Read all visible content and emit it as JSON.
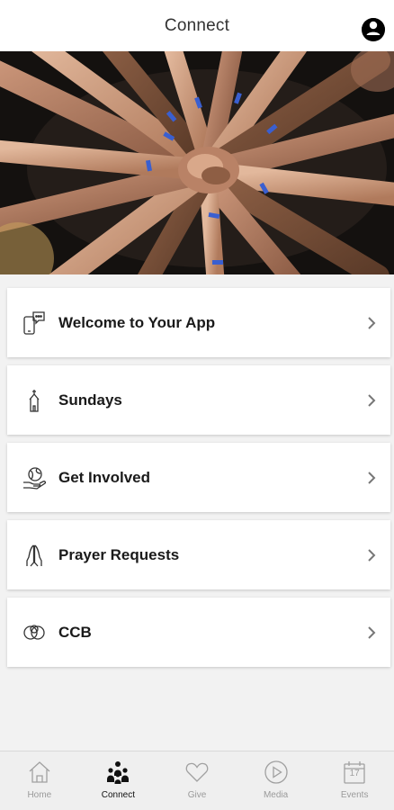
{
  "header": {
    "title": "Connect"
  },
  "hero": {
    "image": "hands-together-photo"
  },
  "list": [
    {
      "label": "Welcome to Your App",
      "icon": "phone-chat-icon"
    },
    {
      "label": "Sundays",
      "icon": "church-icon"
    },
    {
      "label": "Get Involved",
      "icon": "globe-hand-icon"
    },
    {
      "label": "Prayer Requests",
      "icon": "praying-hands-icon"
    },
    {
      "label": "CCB",
      "icon": "circles-icon"
    }
  ],
  "tabs": [
    {
      "label": "Home",
      "icon": "home-icon",
      "active": false
    },
    {
      "label": "Connect",
      "icon": "people-icon",
      "active": true
    },
    {
      "label": "Give",
      "icon": "heart-icon",
      "active": false
    },
    {
      "label": "Media",
      "icon": "play-icon",
      "active": false
    },
    {
      "label": "Events",
      "icon": "calendar-icon",
      "active": false
    }
  ],
  "events_icon_day": "17"
}
